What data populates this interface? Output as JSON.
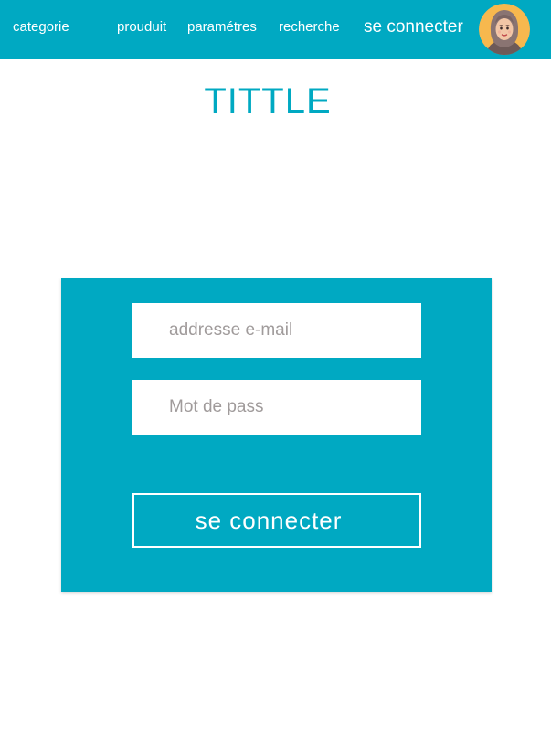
{
  "nav": {
    "categorie": "categorie",
    "produit": "prouduit",
    "parametres": "paramétres",
    "recherche": "recherche",
    "login": "se connecter"
  },
  "page": {
    "title": "TITTLE"
  },
  "login_form": {
    "email_placeholder": "addresse e-mail",
    "password_placeholder": "Mot de pass",
    "submit_label": "se connecter"
  },
  "colors": {
    "accent": "#00a9c2",
    "background": "#ffffff",
    "placeholder_text": "#a09b9b"
  }
}
